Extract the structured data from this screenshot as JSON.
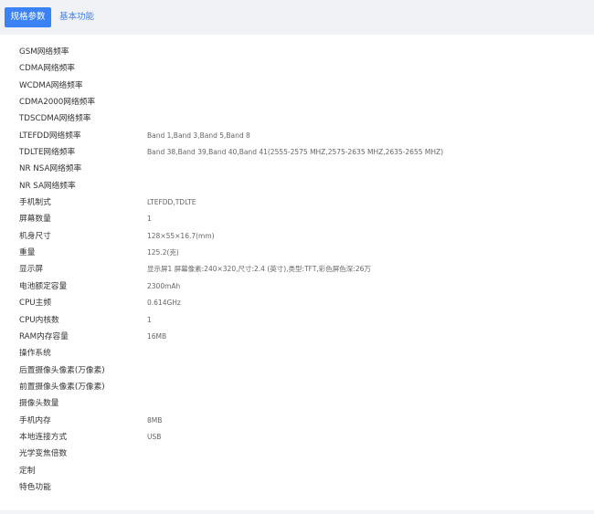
{
  "tabs": {
    "active_label": "规格参数",
    "inactive_label": "基本功能"
  },
  "specs": [
    {
      "label": "GSM网络频率",
      "value": ""
    },
    {
      "label": "CDMA网络频率",
      "value": ""
    },
    {
      "label": "WCDMA网络频率",
      "value": ""
    },
    {
      "label": "CDMA2000网络频率",
      "value": ""
    },
    {
      "label": "TDSCDMA网络频率",
      "value": ""
    },
    {
      "label": "LTEFDD网络频率",
      "value": "Band 1,Band 3,Band 5,Band 8"
    },
    {
      "label": "TDLTE网络频率",
      "value": "Band 38,Band 39,Band 40,Band 41(2555-2575 MHZ,2575-2635 MHZ,2635-2655 MHZ)"
    },
    {
      "label": "NR NSA网络频率",
      "value": ""
    },
    {
      "label": "NR SA网络频率",
      "value": ""
    },
    {
      "label": "手机制式",
      "value": "LTEFDD,TDLTE"
    },
    {
      "label": "屏幕数量",
      "value": "1"
    },
    {
      "label": "机身尺寸",
      "value": "128×55×16.7(mm)"
    },
    {
      "label": "重量",
      "value": "125.2(克)"
    },
    {
      "label": "显示屏",
      "value": "显示屏1 屏幕像素:240×320,尺寸:2.4 (英寸),类型:TFT,彩色屏色深:26万"
    },
    {
      "label": "电池额定容量",
      "value": "2300mAh"
    },
    {
      "label": "CPU主频",
      "value": "0.614GHz"
    },
    {
      "label": "CPU内核数",
      "value": "1"
    },
    {
      "label": "RAM内存容量",
      "value": "16MB"
    },
    {
      "label": "操作系统",
      "value": ""
    },
    {
      "label": "后置摄像头像素(万像素)",
      "value": ""
    },
    {
      "label": "前置摄像头像素(万像素)",
      "value": ""
    },
    {
      "label": "摄像头数量",
      "value": ""
    },
    {
      "label": "手机内存",
      "value": "8MB"
    },
    {
      "label": "本地连接方式",
      "value": "USB"
    },
    {
      "label": "光学变焦倍数",
      "value": ""
    },
    {
      "label": "定制",
      "value": ""
    },
    {
      "label": "特色功能",
      "value": ""
    }
  ]
}
